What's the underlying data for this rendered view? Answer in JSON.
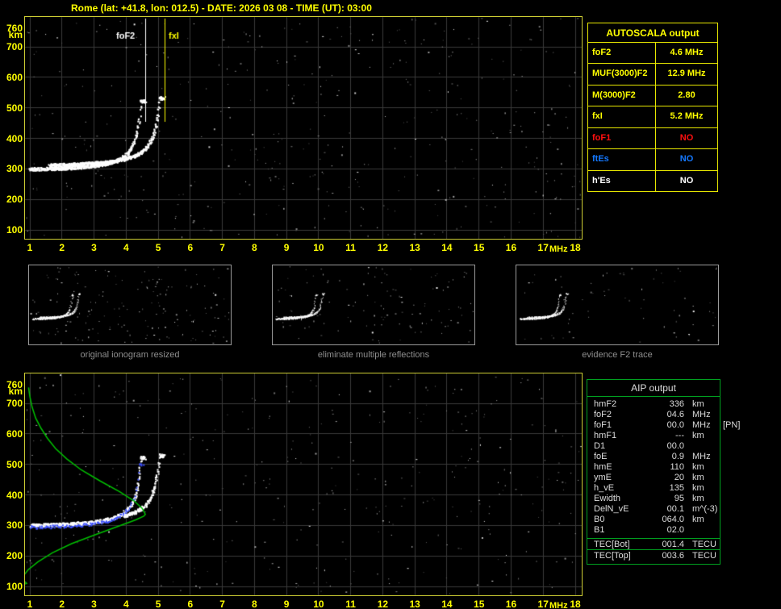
{
  "header": {
    "title": "Rome (lat: +41.8, lon: 012.5) - DATE: 2026 03 08 - TIME (UT): 03:00"
  },
  "colors": {
    "axis_text": "#ffff00",
    "plot_border": "#cccc33",
    "grid_line": "#3a3a3a",
    "trace_white": "#ffffff",
    "trace_blue": "#3c50ff",
    "profile_green": "#00c000",
    "marker_fof2": "#ffffff",
    "marker_fxi": "#ffff00",
    "thumb_border": "#9a9a9a",
    "caption_text": "#8f8f8f",
    "autoscala_border": "#e8e800",
    "autoscala_title": "#ffff00",
    "aip_border": "#00a020",
    "aip_text": "#dcdcdc",
    "value_yellow": "#ffff00",
    "value_red": "#ff1010",
    "value_blue": "#1478ff",
    "value_white": "#ffffff"
  },
  "autoscala_table": {
    "title": "AUTOSCALA output",
    "rows": [
      {
        "label": "foF2",
        "value": "4.6 MHz",
        "color_key": "value_yellow"
      },
      {
        "label": "MUF(3000)F2",
        "value": "12.9 MHz",
        "color_key": "value_yellow"
      },
      {
        "label": "M(3000)F2",
        "value": "2.80",
        "color_key": "value_yellow"
      },
      {
        "label": "fxI",
        "value": "5.2 MHz",
        "color_key": "value_yellow"
      },
      {
        "label": "foF1",
        "value": "NO",
        "color_key": "value_red"
      },
      {
        "label": "ftEs",
        "value": "NO",
        "color_key": "value_blue"
      },
      {
        "label": "h'Es",
        "value": "NO",
        "color_key": "value_white"
      }
    ]
  },
  "aip_table": {
    "title": "AIP output",
    "rows": [
      {
        "label": "hmF2",
        "value": "336",
        "unit": "km"
      },
      {
        "label": "foF2",
        "value": "04.6",
        "unit": "MHz"
      },
      {
        "label": "foF1",
        "value": "00.0",
        "unit": "MHz",
        "extra": "[PN]"
      },
      {
        "label": "hmF1",
        "value": "---",
        "unit": "km"
      },
      {
        "label": "D1",
        "value": "00.0",
        "unit": ""
      },
      {
        "label": "foE",
        "value": "0.9",
        "unit": "MHz"
      },
      {
        "label": "hmE",
        "value": "110",
        "unit": "km"
      },
      {
        "label": "ymE",
        "value": "20",
        "unit": "km"
      },
      {
        "label": "h_vE",
        "value": "135",
        "unit": "km"
      },
      {
        "label": "Ewidth",
        "value": "95",
        "unit": "km"
      },
      {
        "label": "DelN_vE",
        "value": "00.1",
        "unit": "m^(-3)"
      },
      {
        "label": "B0",
        "value": "064.0",
        "unit": "km"
      },
      {
        "label": "B1",
        "value": "02.0",
        "unit": ""
      }
    ],
    "tec_rows": [
      {
        "label": "TEC[Bot]",
        "value": "001.4",
        "unit": "TECU"
      },
      {
        "label": "TEC[Top]",
        "value": "003.6",
        "unit": "TECU"
      }
    ]
  },
  "thumbnails": [
    {
      "caption": "original ionogram resized"
    },
    {
      "caption": "eliminate multiple reflections"
    },
    {
      "caption": "evidence F2 trace"
    }
  ],
  "chart_data": [
    {
      "id": "top_autoscaled_ionogram",
      "type": "scatter",
      "xlabel": "MHz",
      "ylabel": "km",
      "xlim": [
        1,
        18
      ],
      "ylim": [
        100,
        760
      ],
      "grid": true,
      "x_ticks": [
        "1",
        "2",
        "3",
        "4",
        "5",
        "6",
        "7",
        "8",
        "9",
        "10",
        "11",
        "12",
        "13",
        "14",
        "15",
        "16",
        "17",
        "18"
      ],
      "y_ticks": [
        "760",
        "700",
        "600",
        "500",
        "400",
        "300",
        "200",
        "100"
      ],
      "series": [
        {
          "name": "ordinary-trace",
          "color_key": "trace_white",
          "asymptote_mhz": 4.6,
          "base_height_km": 300,
          "start_mhz": 1.0,
          "max_height_km": 523
        },
        {
          "name": "extraordinary-trace",
          "color_key": "trace_white",
          "asymptote_mhz": 5.2,
          "base_height_km": 312,
          "start_mhz": 1.6,
          "max_height_km": 533
        }
      ],
      "annotations": [
        {
          "label": "foF2",
          "mhz": 4.6,
          "color_key": "marker_fof2",
          "side": "left"
        },
        {
          "label": "fxI",
          "mhz": 5.2,
          "color_key": "marker_fxi",
          "side": "right"
        }
      ]
    },
    {
      "id": "bottom_profile_ionogram",
      "type": "scatter",
      "xlabel": "MHz",
      "ylabel": "km",
      "xlim": [
        1,
        18
      ],
      "ylim": [
        100,
        760
      ],
      "grid": true,
      "x_ticks": [
        "1",
        "2",
        "3",
        "4",
        "5",
        "6",
        "7",
        "8",
        "9",
        "10",
        "11",
        "12",
        "13",
        "14",
        "15",
        "16",
        "17",
        "18"
      ],
      "y_ticks": [
        "760",
        "700",
        "600",
        "500",
        "400",
        "300",
        "200",
        "100"
      ],
      "series": [
        {
          "name": "ordinary-trace",
          "color_key": "trace_white",
          "asymptote_mhz": 4.6,
          "base_height_km": 301,
          "start_mhz": 1.0,
          "max_height_km": 523
        },
        {
          "name": "extraordinary-trace",
          "color_key": "trace_white",
          "asymptote_mhz": 5.2,
          "base_height_km": 312,
          "start_mhz": 3.9,
          "max_height_km": 530
        },
        {
          "name": "restored-trace",
          "color_key": "trace_blue",
          "asymptote_mhz": 4.55,
          "base_height_km": 295,
          "start_mhz": 1.0,
          "max_height_km": 500
        },
        {
          "name": "electron-density-profile",
          "color_key": "profile_green",
          "points_mhz_km": [
            [
              0.55,
              95
            ],
            [
              0.9,
              110
            ],
            [
              0.8,
              120
            ],
            [
              0.78,
              132
            ],
            [
              0.95,
              155
            ],
            [
              1.25,
              180
            ],
            [
              1.7,
              210
            ],
            [
              2.3,
              240
            ],
            [
              3.0,
              268
            ],
            [
              3.7,
              295
            ],
            [
              4.3,
              318
            ],
            [
              4.55,
              330
            ],
            [
              4.6,
              336
            ],
            [
              4.5,
              356
            ],
            [
              4.25,
              380
            ],
            [
              3.8,
              410
            ],
            [
              3.2,
              445
            ],
            [
              2.6,
              482
            ],
            [
              2.15,
              518
            ],
            [
              1.8,
              552
            ],
            [
              1.55,
              585
            ],
            [
              1.35,
              618
            ],
            [
              1.18,
              652
            ],
            [
              1.07,
              688
            ],
            [
              1.0,
              722
            ],
            [
              0.96,
              752
            ]
          ]
        }
      ]
    }
  ]
}
